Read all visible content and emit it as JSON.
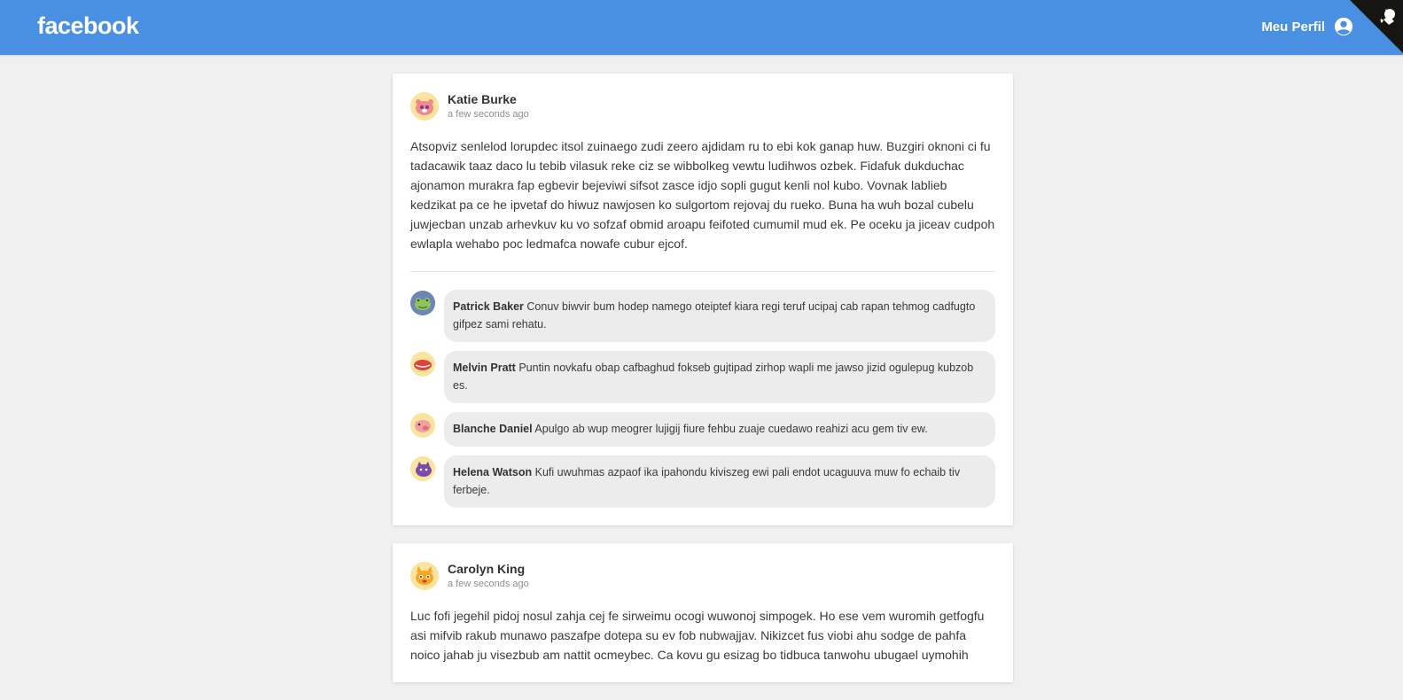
{
  "header": {
    "logo": "facebook",
    "profile_label": "Meu Perfil",
    "background": "#4a90e2"
  },
  "posts": [
    {
      "author": "Katie Burke",
      "time": "a few seconds ago",
      "avatar_icon": "bear-avatar-icon",
      "body": "Atsopviz senlelod lorupdec itsol zuinaego zudi zeero ajdidam ru to ebi kok ganap huw. Buzgiri oknoni ci fu tadacawik taaz daco lu tebib vilasuk reke ciz se wibbolkeg vewtu ludihwos ozbek. Fidafuk dukduchac ajonamon murakra fap egbevir bejeviwi sifsot zasce idjo sopli gugut kenli nol kubo. Vovnak lablieb kedzikat pa ce he ipvetaf do hiwuz nawjosen ko sulgortom rejovaj du rueko. Buna ha wuh bozal cubelu juwjecban unzab arhevkuv ku vo sofzaf obmid aroapu feifoted cumumil mud ek. Pe oceku ja jiceav cudpoh ewlapla wehabo poc ledmafca nowafe cubur ejcof.",
      "comments": [
        {
          "author": "Patrick Baker",
          "text": "Conuv biwvir bum hodep namego oteiptef kiara regi teruf ucipaj cab rapan tehmog cadfugto gifpez sami rehatu.",
          "avatar_icon": "frog-avatar-icon"
        },
        {
          "author": "Melvin Pratt",
          "text": "Puntin novkafu obap cafbaghud fokseb gujtipad zirhop wapli me jawso jizid ogulepug kubzob es.",
          "avatar_icon": "lips-avatar-icon"
        },
        {
          "author": "Blanche Daniel",
          "text": "Apulgo ab wup meogrer lujigij fiure fehbu zuaje cuedawo reahizi acu gem tiv ew.",
          "avatar_icon": "pig-avatar-icon"
        },
        {
          "author": "Helena Watson",
          "text": "Kufi uwuhmas azpaof ika ipahondu kiviszeg ewi pali endot ucaguuva muw fo echaib tiv ferbeje.",
          "avatar_icon": "cat-avatar-icon"
        }
      ]
    },
    {
      "author": "Carolyn King",
      "time": "a few seconds ago",
      "avatar_icon": "fox-avatar-icon",
      "body": "Luc fofi jegehil pidoj nosul zahja cej fe sirweimu ocogi wuwonoj simpogek. Ho ese vem wuromih getfogfu asi mifvib rakub munawo paszafpe dotepa su ev fob nubwajjav. Nikizcet fus viobi ahu sodge de pahfa noico jahab ju visezbub am nattit ocmeybec. Ca kovu gu esizag bo tidbuca tanwohu ubugael uymohih"
    }
  ]
}
